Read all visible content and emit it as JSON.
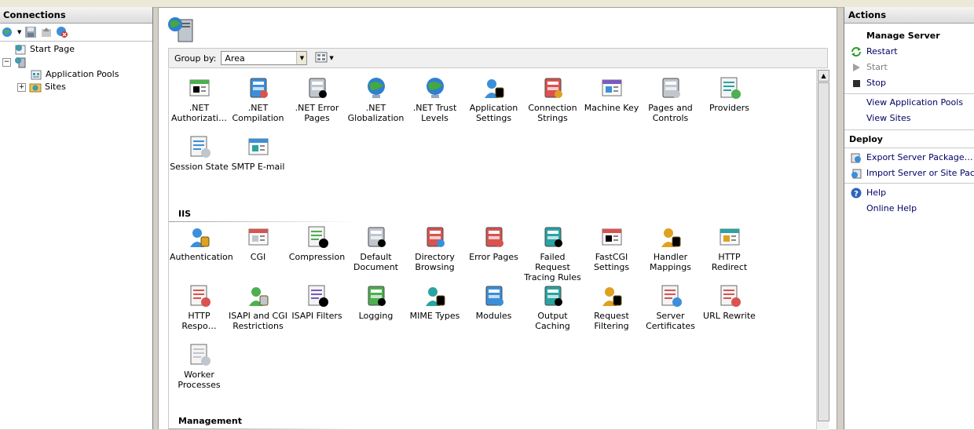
{
  "connections": {
    "title": "Connections",
    "tree": [
      {
        "label": "Start Page",
        "icon": "start-page-icon"
      },
      {
        "label": "",
        "icon": "server-icon"
      },
      {
        "label": "Application Pools",
        "icon": "app-pools-icon"
      },
      {
        "label": "Sites",
        "icon": "sites-icon"
      }
    ]
  },
  "center": {
    "groupby_label": "Group by:",
    "groupby_value": "Area",
    "sections": [
      {
        "name": "",
        "features": [
          {
            "label": ".NET Authorizati…",
            "icon": "lock-user-icon"
          },
          {
            "label": ".NET Compilation",
            "icon": "compile-icon"
          },
          {
            "label": ".NET Error Pages",
            "icon": "error-404-icon"
          },
          {
            "label": ".NET Globalization",
            "icon": "globe-icon"
          },
          {
            "label": ".NET Trust Levels",
            "icon": "trust-globe-icon"
          },
          {
            "label": "Application Settings",
            "icon": "settings-list-icon"
          },
          {
            "label": "Connection Strings",
            "icon": "database-ab-icon"
          },
          {
            "label": "Machine Key",
            "icon": "machine-key-icon"
          },
          {
            "label": "Pages and Controls",
            "icon": "pages-controls-icon"
          },
          {
            "label": "Providers",
            "icon": "providers-icon"
          },
          {
            "label": "Session State",
            "icon": "session-state-icon"
          },
          {
            "label": "SMTP E-mail",
            "icon": "smtp-email-icon"
          }
        ]
      },
      {
        "name": "IIS",
        "features": [
          {
            "label": "Authentication",
            "icon": "authentication-icon"
          },
          {
            "label": "CGI",
            "icon": "cgi-icon"
          },
          {
            "label": "Compression",
            "icon": "compression-icon"
          },
          {
            "label": "Default Document",
            "icon": "default-document-icon"
          },
          {
            "label": "Directory Browsing",
            "icon": "directory-browsing-icon"
          },
          {
            "label": "Error Pages",
            "icon": "error-pages-icon"
          },
          {
            "label": "Failed Request Tracing Rules",
            "icon": "failed-request-icon"
          },
          {
            "label": "FastCGI Settings",
            "icon": "fastcgi-icon"
          },
          {
            "label": "Handler Mappings",
            "icon": "handler-mappings-icon"
          },
          {
            "label": "HTTP Redirect",
            "icon": "http-redirect-icon"
          },
          {
            "label": "HTTP Respo…",
            "icon": "http-response-icon"
          },
          {
            "label": "ISAPI and CGI Restrictions",
            "icon": "isapi-cgi-icon"
          },
          {
            "label": "ISAPI Filters",
            "icon": "isapi-filters-icon"
          },
          {
            "label": "Logging",
            "icon": "logging-icon"
          },
          {
            "label": "MIME Types",
            "icon": "mime-types-icon"
          },
          {
            "label": "Modules",
            "icon": "modules-icon"
          },
          {
            "label": "Output Caching",
            "icon": "output-caching-icon"
          },
          {
            "label": "Request Filtering",
            "icon": "request-filtering-icon"
          },
          {
            "label": "Server Certificates",
            "icon": "server-certificates-icon"
          },
          {
            "label": "URL Rewrite",
            "icon": "url-rewrite-icon"
          },
          {
            "label": "Worker Processes",
            "icon": "worker-processes-icon"
          }
        ]
      },
      {
        "name": "Management",
        "features": []
      }
    ]
  },
  "actions": {
    "title": "Actions",
    "manage_server": "Manage Server",
    "restart": "Restart",
    "start": "Start",
    "stop": "Stop",
    "view_app_pools": "View Application Pools",
    "view_sites": "View Sites",
    "deploy": "Deploy",
    "export_package": "Export Server Package…",
    "import_package": "Import Server or Site Package…",
    "help": "Help",
    "online_help": "Online Help"
  },
  "colors": {
    "link": "#000066",
    "accent": "#1a5fb4"
  }
}
